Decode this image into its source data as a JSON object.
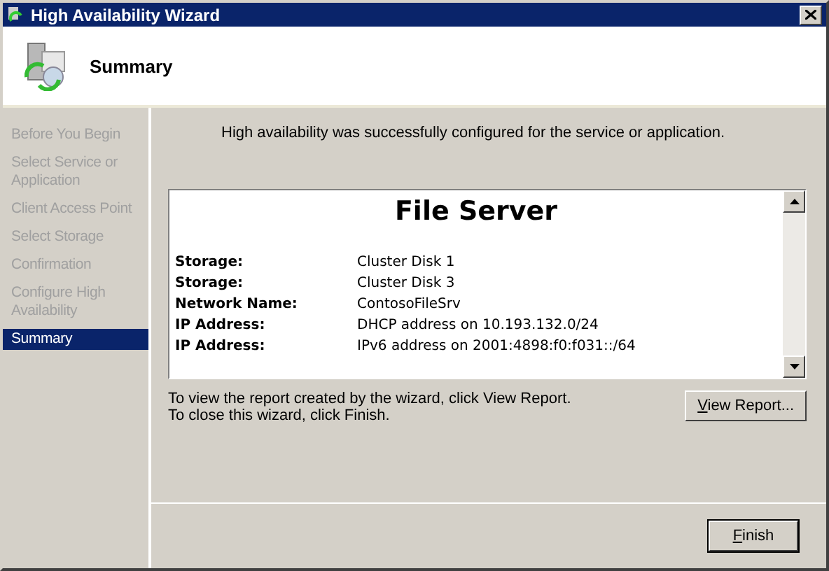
{
  "window": {
    "title": "High Availability Wizard"
  },
  "header": {
    "title": "Summary"
  },
  "steps": [
    {
      "label": "Before You Begin",
      "selected": false
    },
    {
      "label": "Select Service or Application",
      "selected": false
    },
    {
      "label": "Client Access Point",
      "selected": false
    },
    {
      "label": "Select Storage",
      "selected": false
    },
    {
      "label": "Confirmation",
      "selected": false
    },
    {
      "label": "Configure High Availability",
      "selected": false
    },
    {
      "label": "Summary",
      "selected": true
    }
  ],
  "message": "High availability was successfully configured for the service or application.",
  "report": {
    "title": "File Server",
    "rows": [
      {
        "label": "Storage:",
        "value": "Cluster Disk 1"
      },
      {
        "label": "Storage:",
        "value": "Cluster Disk 3"
      },
      {
        "label": "Network Name:",
        "value": "ContosoFileSrv"
      },
      {
        "label": "IP Address:",
        "value": "DHCP address on 10.193.132.0/24"
      },
      {
        "label": "IP Address:",
        "value": "IPv6 address on 2001:4898:f0:f031::/64"
      }
    ]
  },
  "hints": [
    "To view the report created by the wizard, click View Report.",
    "To close this wizard, click Finish."
  ],
  "buttons": {
    "view_report": "View Report...",
    "finish": "Finish"
  }
}
